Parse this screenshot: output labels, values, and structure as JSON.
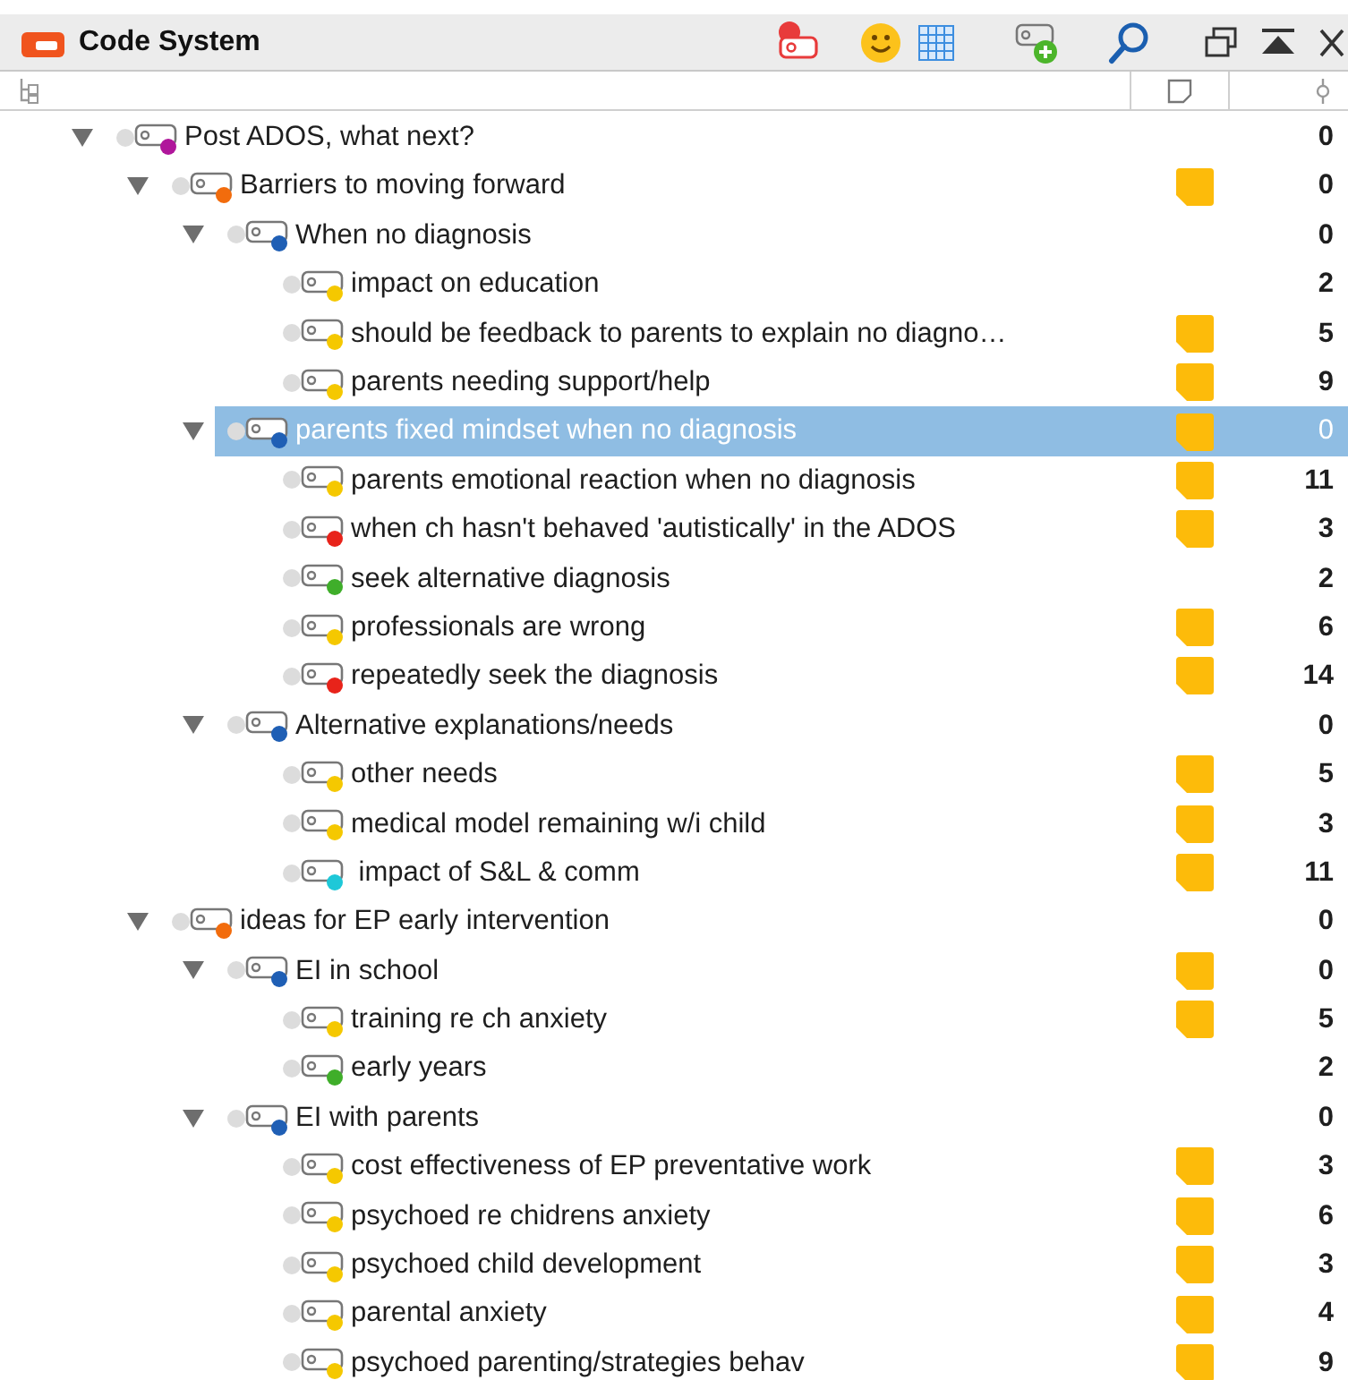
{
  "window": {
    "title": "Code System"
  },
  "codes": [
    {
      "label": "Post ADOS, what next?",
      "color": "#b0169b",
      "memo": false,
      "count": "0",
      "selected": false,
      "expanded": true,
      "children": [
        {
          "label": "Barriers to moving forward",
          "color": "#f26c0d",
          "memo": true,
          "count": "0",
          "selected": false,
          "expanded": true,
          "children": [
            {
              "label": "When no diagnosis",
              "color": "#1f5fb5",
              "memo": false,
              "count": "0",
              "selected": false,
              "expanded": true,
              "children": [
                {
                  "label": "impact on education",
                  "color": "#f5c800",
                  "memo": false,
                  "count": "2",
                  "selected": false
                },
                {
                  "label": "should be feedback to parents to explain no diagno…",
                  "color": "#f5c800",
                  "memo": true,
                  "count": "5",
                  "selected": false
                },
                {
                  "label": "parents needing support/help",
                  "color": "#f5c800",
                  "memo": true,
                  "count": "9",
                  "selected": false
                }
              ]
            },
            {
              "label": "parents fixed mindset when no diagnosis",
              "color": "#1f5fb5",
              "memo": true,
              "count": "0",
              "selected": true,
              "expanded": true,
              "children": [
                {
                  "label": "parents emotional reaction when no diagnosis",
                  "color": "#f5c800",
                  "memo": true,
                  "count": "11",
                  "selected": false
                },
                {
                  "label": "when ch hasn't behaved 'autistically' in the ADOS",
                  "color": "#e8231a",
                  "memo": true,
                  "count": "3",
                  "selected": false
                },
                {
                  "label": "seek alternative diagnosis",
                  "color": "#3fae2a",
                  "memo": false,
                  "count": "2",
                  "selected": false
                },
                {
                  "label": "professionals are wrong",
                  "color": "#f5c800",
                  "memo": true,
                  "count": "6",
                  "selected": false
                },
                {
                  "label": "repeatedly seek the diagnosis",
                  "color": "#e8231a",
                  "memo": true,
                  "count": "14",
                  "selected": false
                }
              ]
            },
            {
              "label": "Alternative explanations/needs",
              "color": "#1f5fb5",
              "memo": false,
              "count": "0",
              "selected": false,
              "expanded": true,
              "children": [
                {
                  "label": "other needs",
                  "color": "#f5c800",
                  "memo": true,
                  "count": "5",
                  "selected": false
                },
                {
                  "label": "medical model remaining w/i child",
                  "color": "#f5c800",
                  "memo": true,
                  "count": "3",
                  "selected": false
                },
                {
                  "label": " impact of S&L & comm",
                  "color": "#1ec8d8",
                  "memo": true,
                  "count": "11",
                  "selected": false
                }
              ]
            }
          ]
        },
        {
          "label": "ideas for EP early intervention",
          "color": "#f26c0d",
          "memo": false,
          "count": "0",
          "selected": false,
          "expanded": true,
          "children": [
            {
              "label": "EI in school",
              "color": "#1f5fb5",
              "memo": true,
              "count": "0",
              "selected": false,
              "expanded": true,
              "children": [
                {
                  "label": "training re ch anxiety",
                  "color": "#f5c800",
                  "memo": true,
                  "count": "5",
                  "selected": false
                },
                {
                  "label": "early years",
                  "color": "#3fae2a",
                  "memo": false,
                  "count": "2",
                  "selected": false
                }
              ]
            },
            {
              "label": "EI with parents",
              "color": "#1f5fb5",
              "memo": false,
              "count": "0",
              "selected": false,
              "expanded": true,
              "children": [
                {
                  "label": "cost effectiveness of EP preventative work",
                  "color": "#f5c800",
                  "memo": true,
                  "count": "3",
                  "selected": false
                },
                {
                  "label": "psychoed re chidrens anxiety",
                  "color": "#f5c800",
                  "memo": true,
                  "count": "6",
                  "selected": false
                },
                {
                  "label": "psychoed child development",
                  "color": "#f5c800",
                  "memo": true,
                  "count": "3",
                  "selected": false
                },
                {
                  "label": "parental anxiety",
                  "color": "#f5c800",
                  "memo": true,
                  "count": "4",
                  "selected": false
                },
                {
                  "label": "psychoed parenting/strategies behav",
                  "color": "#f5c800",
                  "memo": true,
                  "count": "9",
                  "selected": false
                }
              ]
            }
          ]
        }
      ]
    }
  ]
}
